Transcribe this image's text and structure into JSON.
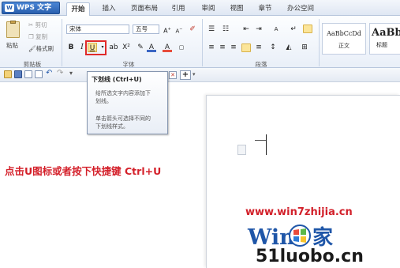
{
  "app": {
    "menu_button_label": "WPS 文字",
    "logo_letter": "W"
  },
  "tabs": [
    {
      "label": "开始",
      "active": true
    },
    {
      "label": "插入"
    },
    {
      "label": "页面布局"
    },
    {
      "label": "引用"
    },
    {
      "label": "审阅"
    },
    {
      "label": "视图"
    },
    {
      "label": "章节"
    },
    {
      "label": "办公空间"
    }
  ],
  "ribbon": {
    "clipboard": {
      "paste": "粘贴",
      "cut": "剪切",
      "copy": "复制",
      "format_painter": "格式刷",
      "group_label": "剪贴板"
    },
    "font": {
      "font_name": "宋体",
      "font_size": "五号",
      "bold": "B",
      "italic": "I",
      "underline": "U",
      "group_label": "字体"
    },
    "paragraph": {
      "group_label": "段落"
    },
    "styles": {
      "normal_sample": "AaBbCcDd",
      "normal_label": "正文",
      "heading_sample": "AaBb",
      "heading_label": "标题"
    }
  },
  "tooltip": {
    "title": "下划线 (Ctrl+U)",
    "desc_line1": "给所选文字内容添加下",
    "desc_line2": "划线。",
    "hint_line1": "单击箭头可选择不同的",
    "hint_line2": "下划线样式。"
  },
  "instruction": "点击U图标或者按下快捷键 Ctrl+U",
  "watermark": {
    "url": "www.win7zhijia.cn",
    "brand": "51luobo.cn",
    "brand_prefix": "Win"
  },
  "colors": {
    "accent": "#2a5fae",
    "highlight_red": "#e02a2a",
    "instruction_red": "#d4202a"
  }
}
